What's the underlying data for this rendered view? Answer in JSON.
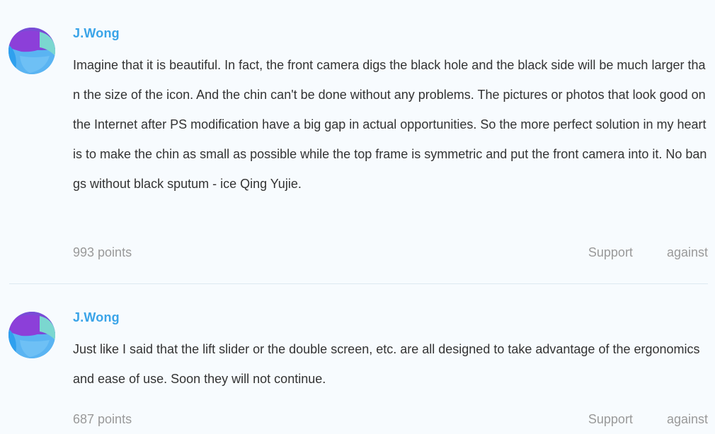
{
  "comments": [
    {
      "author": "J.Wong",
      "text": "Imagine that it is beautiful. In fact, the front camera digs the black hole and the black side will be much larger than the size of the icon. And the chin can't be done without any problems. The pictures or photos that look good on the Internet after PS modification have a big gap in actual opportunities. So the more perfect solution in my heart is to make the chin as small as possible while the top frame is symmetric and put the front camera into it. No bangs without black sputum - ice Qing Yujie.",
      "points": "993 points",
      "support_label": "Support",
      "against_label": "against"
    },
    {
      "author": "J.Wong",
      "text": "Just like I said that the lift slider or the double screen, etc. are all designed to take advantage of the ergonomics and ease of use. Soon they will not continue.",
      "points": "687 points",
      "support_label": "Support",
      "against_label": "against"
    }
  ],
  "colors": {
    "background": "#f7fbfe",
    "author": "#3aa4e8",
    "text": "#333333",
    "muted": "#999999",
    "divider": "#dce8f1"
  }
}
